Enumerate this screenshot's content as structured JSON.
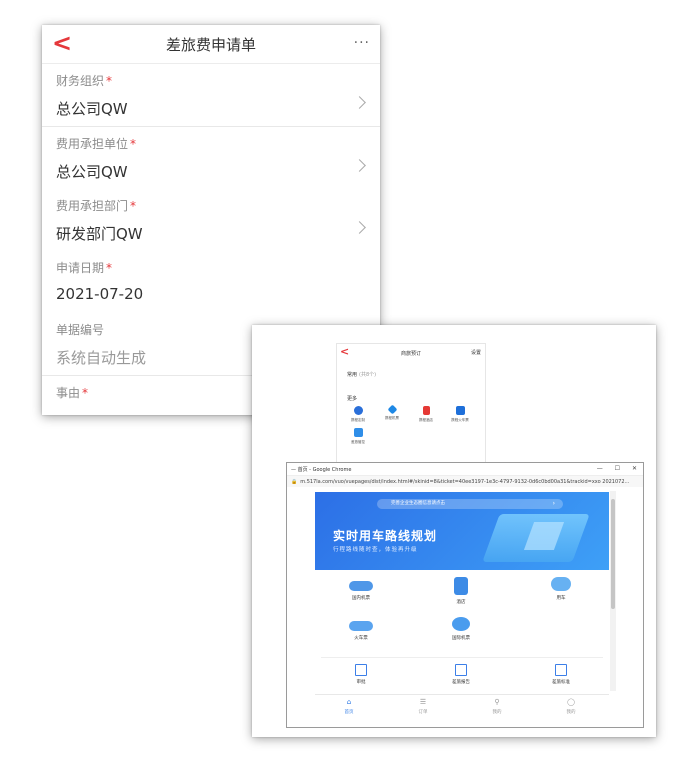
{
  "form": {
    "title": "差旅费申请单",
    "more": "···",
    "back": "<",
    "required_mark": "*",
    "fields": [
      {
        "label": "财务组织",
        "value": "总公司QW"
      },
      {
        "label": "费用承担单位",
        "value": "总公司QW"
      },
      {
        "label": "费用承担部门",
        "value": "研发部门QW"
      },
      {
        "label": "申请日期",
        "value": "2021-07-20"
      },
      {
        "label": "单据编号",
        "value": "系统自动生成"
      },
      {
        "label": "事由",
        "value": ""
      }
    ]
  },
  "travel_app": {
    "title": "商旅预订",
    "settings": "设置",
    "common_label": "常用",
    "common_count": "(共8个)",
    "more_label": "更多",
    "icons": [
      {
        "label": "携程定制",
        "color": "#2a6fd9"
      },
      {
        "label": "携程机票",
        "color": "#1e88e5"
      },
      {
        "label": "携程酒店",
        "color": "#e53935"
      },
      {
        "label": "携程火车票",
        "color": "#1e6fd9"
      },
      {
        "label": "差旅管控",
        "color": "#2f8ee8"
      }
    ]
  },
  "browser": {
    "window_title": "— 首页 - Google Chrome",
    "controls": "— ☐ ✕",
    "lock": "🔒",
    "url": "m.517la.com/vuo/vuepages/dist/index.html#/skinid=8&ticket=40ee3197-1e3c-4797-9132-0d6c0bd00a31&trackid=xxo 2021072...",
    "banner_note": "完善企业生态圈信息请点击",
    "banner_arrow": "›",
    "banner_title": "实时用车路线规划",
    "banner_subtitle": "行程路线随时查，体验再升级",
    "services": [
      {
        "label": "国内机票"
      },
      {
        "label": "酒店"
      },
      {
        "label": "用车"
      },
      {
        "label": "火车票"
      },
      {
        "label": "国际机票"
      }
    ],
    "tools": [
      {
        "label": "审批"
      },
      {
        "label": "差旅报告"
      },
      {
        "label": "差旅标准"
      }
    ],
    "tabs": [
      {
        "label": "首页",
        "icon": "⌂"
      },
      {
        "label": "订单",
        "icon": "☰"
      },
      {
        "label": "我的",
        "icon": "⚲"
      },
      {
        "label": "我的",
        "icon": "◯"
      }
    ]
  }
}
